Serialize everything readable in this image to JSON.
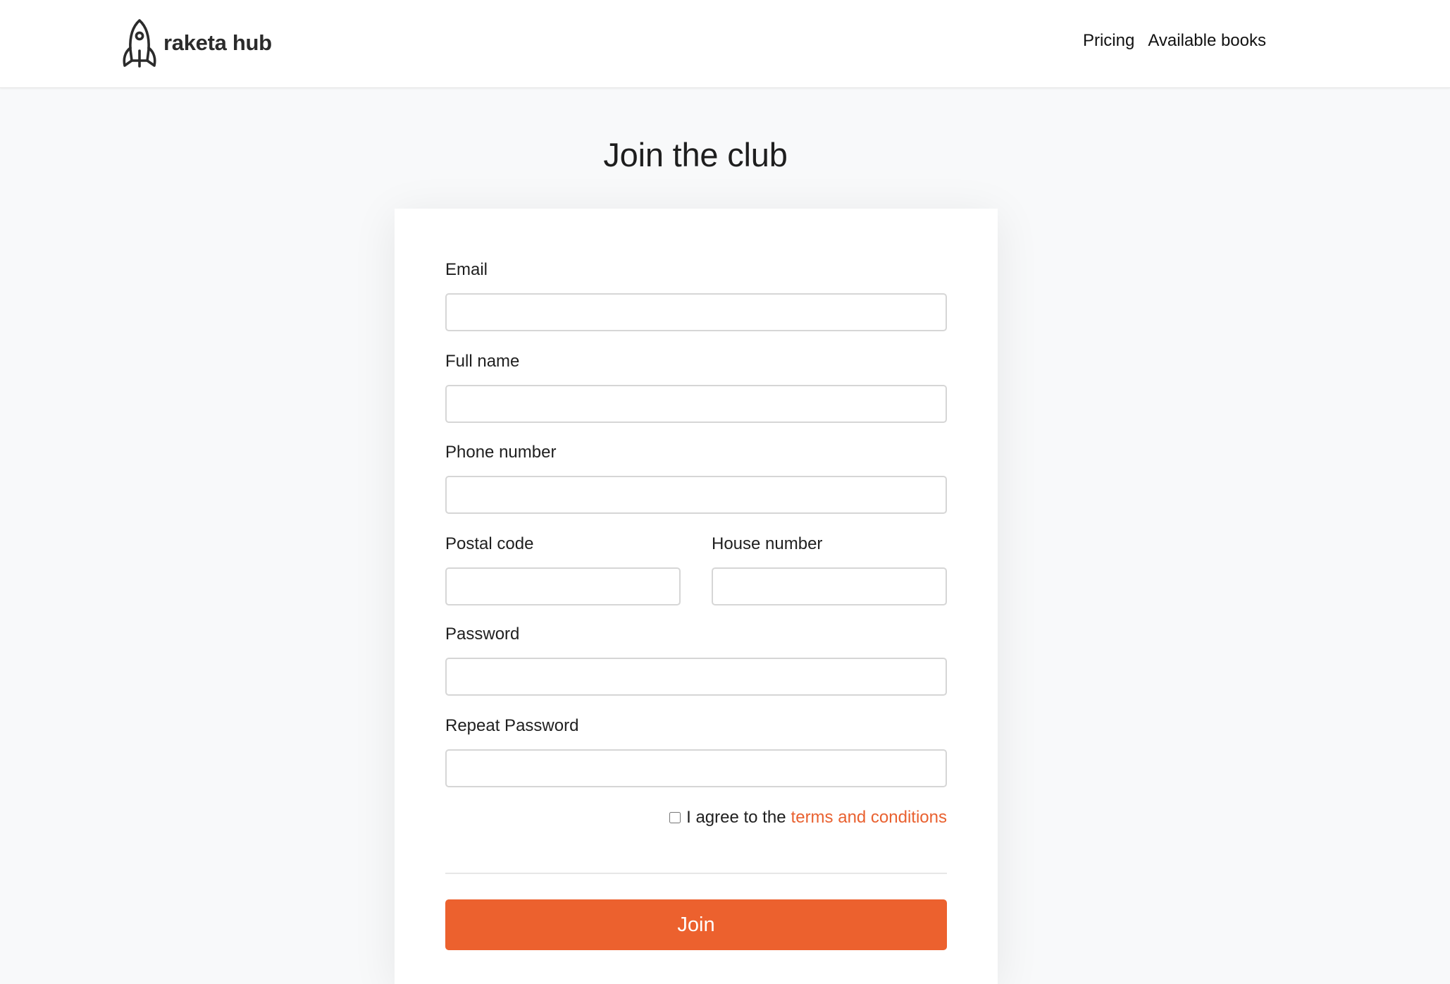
{
  "header": {
    "brand_name": "raketa hub",
    "brand_icon": "rocket-icon",
    "nav": [
      {
        "label": "Pricing"
      },
      {
        "label": "Available books"
      }
    ]
  },
  "page": {
    "title": "Join the club"
  },
  "form": {
    "email_label": "Email",
    "email_value": "",
    "full_name_label": "Full name",
    "full_name_value": "",
    "phone_label": "Phone number",
    "phone_value": "",
    "postal_code_label": "Postal code",
    "postal_code_value": "",
    "house_number_label": "House number",
    "house_number_value": "",
    "password_label": "Password",
    "password_value": "",
    "repeat_password_label": "Repeat Password",
    "repeat_password_value": "",
    "agree_text": "I agree to the",
    "terms_link": "terms and conditions",
    "agree_checked": false,
    "submit_label": "Join"
  },
  "colors": {
    "accent": "#ec612e",
    "link": "#e96130",
    "background": "#f8f9fa",
    "card": "#ffffff"
  }
}
